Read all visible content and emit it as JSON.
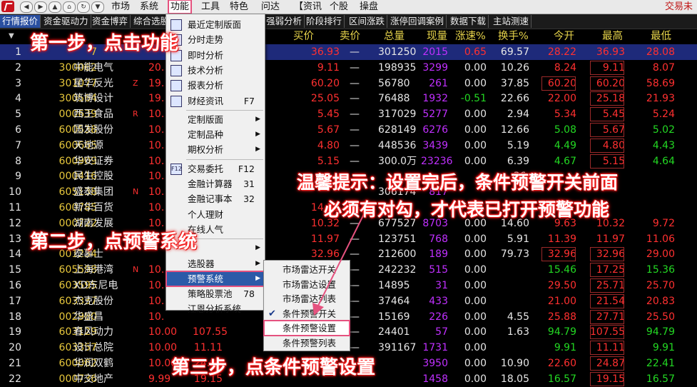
{
  "menubar": {
    "items": [
      "市场",
      "系统",
      "功能",
      "工具",
      "特色",
      "问达",
      "资讯",
      "个股",
      "操盘"
    ],
    "brand": "交易未"
  },
  "tabs": [
    "行情报价",
    "资金驱动力",
    "资金博弈",
    "综合选股",
    "强弱分析",
    "阶段排行",
    "区间涨跌",
    "涨停回调案例",
    "数据下载",
    "主站测速"
  ],
  "header": {
    "cols": [
      "买价",
      "卖价",
      "总量",
      "现量",
      "涨速%",
      "换手%",
      "今开",
      "最高",
      "最低"
    ]
  },
  "rows": [
    {
      "n": "1",
      "code": "7",
      "name": "",
      "a": "",
      "b": "",
      "buy": "36.93",
      "sell": "—",
      "vol": "301250",
      "cur": "2015",
      "spd": "0.65",
      "turn": "69.57",
      "open": "28.22",
      "high": "36.93",
      "low": "28.08"
    },
    {
      "n": "2",
      "code": "300062",
      "name": "中能电气",
      "a": "20.",
      "b": "",
      "buy": "9.11",
      "sell": "—",
      "vol": "198935",
      "cur": "3299",
      "spd": "0.00",
      "turn": "10.26",
      "open": "8.24",
      "high": "9.11",
      "low": "8.07"
    },
    {
      "n": "3",
      "code": "301077",
      "name": "星华反光",
      "a": "19.",
      "b": "Z",
      "buy": "60.20",
      "sell": "—",
      "vol": "56780",
      "cur": "261",
      "spd": "0.00",
      "turn": "37.85",
      "open": "60.20",
      "high": "60.20",
      "low": "58.69"
    },
    {
      "n": "4",
      "code": "300564",
      "name": "筑博设计",
      "a": "19.",
      "b": "",
      "buy": "25.05",
      "sell": "—",
      "vol": "76488",
      "cur": "1932",
      "spd": "-0.51",
      "turn": "22.66",
      "open": "22.00",
      "high": "25.18",
      "low": "21.93"
    },
    {
      "n": "5",
      "code": "000639",
      "name": "西王食品",
      "a": "10.",
      "b": "R",
      "buy": "5.45",
      "sell": "—",
      "vol": "317029",
      "cur": "5277",
      "spd": "0.00",
      "turn": "2.94",
      "open": "5.34",
      "high": "5.45",
      "low": "5.24"
    },
    {
      "n": "6",
      "code": "600538",
      "name": "国发股份",
      "a": "10.",
      "b": "",
      "buy": "5.67",
      "sell": "—",
      "vol": "628149",
      "cur": "6276",
      "spd": "0.00",
      "turn": "12.66",
      "open": "5.08",
      "high": "5.67",
      "low": "5.02"
    },
    {
      "n": "7",
      "code": "600665",
      "name": "天地源",
      "a": "10.",
      "b": "",
      "buy": "4.80",
      "sell": "—",
      "vol": "448536",
      "cur": "3439",
      "spd": "0.00",
      "turn": "5.19",
      "open": "4.49",
      "high": "4.80",
      "low": "4.43"
    },
    {
      "n": "8",
      "code": "600909",
      "name": "华安证券",
      "a": "10.",
      "b": "",
      "buy": "5.15",
      "sell": "—",
      "vol": "300.0万",
      "cur": "23236",
      "spd": "0.00",
      "turn": "6.39",
      "open": "4.67",
      "high": "5.15",
      "low": "4.64"
    },
    {
      "n": "9",
      "code": "000416",
      "name": "民生控股",
      "a": "10.",
      "b": "",
      "buy": "",
      "sell": "",
      "vol": "",
      "cur": "",
      "spd": "",
      "turn": "36.",
      "open": "",
      "high": "",
      "low": ""
    },
    {
      "n": "10",
      "code": "605138",
      "name": "盛泰集团",
      "a": "10.",
      "b": "N",
      "buy": "",
      "sell": "",
      "vol": "306174",
      "cur": "817",
      "spd": "",
      "turn": "",
      "open": "",
      "high": "",
      "low": ""
    },
    {
      "n": "11",
      "code": "600785",
      "name": "新华百货",
      "a": "10.",
      "b": "",
      "buy": "14.38",
      "sell": "—",
      "vol": "",
      "cur": "",
      "spd": "",
      "turn": "",
      "open": "",
      "high": "",
      "low": ""
    },
    {
      "n": "12",
      "code": "000722",
      "name": "湖南发展",
      "a": "10.",
      "b": "",
      "buy": "10.32",
      "sell": "—",
      "vol": "677527",
      "cur": "8703",
      "spd": "0.00",
      "turn": "14.60",
      "open": "9.63",
      "high": "10.32",
      "low": "9.72"
    },
    {
      "n": "13",
      "code": "",
      "name": "",
      "a": "",
      "b": "",
      "buy": "11.97",
      "sell": "—",
      "vol": "123751",
      "cur": "768",
      "spd": "0.00",
      "turn": "5.91",
      "open": "11.39",
      "high": "11.97",
      "low": "11.06"
    },
    {
      "n": "14",
      "code": "001234",
      "name": "泰慕士",
      "a": "",
      "b": "",
      "buy": "32.96",
      "sell": "—",
      "vol": "212600",
      "cur": "189",
      "spd": "0.00",
      "turn": "79.73",
      "open": "32.96",
      "high": "32.96",
      "low": "29.00"
    },
    {
      "n": "15",
      "code": "605598",
      "name": "上海港湾",
      "a": "10.",
      "b": "N",
      "buy": "",
      "sell": "—",
      "vol": "242232",
      "cur": "515",
      "spd": "0.00",
      "turn": "",
      "open": "15.46",
      "high": "17.25",
      "low": "15.36"
    },
    {
      "n": "16",
      "code": "603595",
      "name": "XD东尼电",
      "a": "10.",
      "b": "",
      "buy": "",
      "sell": "—",
      "vol": "14895",
      "cur": "31",
      "spd": "0.00",
      "turn": "",
      "open": "29.50",
      "high": "25.71",
      "low": "25.70"
    },
    {
      "n": "17",
      "code": "603337",
      "name": "杰克股份",
      "a": "10.",
      "b": "",
      "buy": "",
      "sell": "—",
      "vol": "37464",
      "cur": "433",
      "spd": "0.00",
      "turn": "",
      "open": "21.00",
      "high": "21.54",
      "low": "20.83"
    },
    {
      "n": "18",
      "code": "002980",
      "name": "华盛昌",
      "a": "10.",
      "b": "",
      "buy": "",
      "sell": "—",
      "vol": "15169",
      "cur": "226",
      "spd": "0.00",
      "turn": "4.55",
      "open": "25.88",
      "high": "27.71",
      "low": "25.50"
    },
    {
      "n": "19",
      "code": "603129",
      "name": "春风动力",
      "a": "10.00",
      "b": "",
      "c": "107.55",
      "buy": "",
      "sell": "—",
      "vol": "24401",
      "cur": "57",
      "spd": "0.00",
      "turn": "1.63",
      "open": "94.79",
      "high": "107.55",
      "low": "94.79"
    },
    {
      "n": "20",
      "code": "603357",
      "name": "设计总院",
      "a": "10.00",
      "b": "",
      "c": "11.11",
      "buy": "",
      "sell": "—",
      "vol": "391167",
      "cur": "1731",
      "spd": "0.00",
      "turn": "",
      "open": "9.91",
      "high": "11.11",
      "low": "9.91"
    },
    {
      "n": "21",
      "code": "600062",
      "name": "华润双鹤",
      "a": "10.00",
      "b": "",
      "c": "24.87",
      "buy": "",
      "sell": "",
      "vol": "",
      "cur": "3950",
      "spd": "0.00",
      "turn": "10.90",
      "open": "22.60",
      "high": "24.87",
      "low": "22.41"
    },
    {
      "n": "22",
      "code": "000736",
      "name": "中交地产",
      "a": "9.99",
      "b": "",
      "c": "19.15",
      "buy": "",
      "sell": "",
      "vol": "",
      "cur": "1458",
      "spd": "0.00",
      "turn": "18.05",
      "open": "16.57",
      "high": "19.15",
      "low": "16.57"
    }
  ],
  "menu1": {
    "items": [
      {
        "label": "最近定制版面",
        "sc": "",
        "arrow": false,
        "icon": "layout-icon"
      },
      {
        "label": "分时走势",
        "sc": "",
        "arrow": false,
        "icon": "chart-icon",
        "partial": "价"
      },
      {
        "label": "即时分析",
        "sc": "",
        "arrow": false,
        "icon": "analysis-icon"
      },
      {
        "label": "技术分析",
        "sc": "",
        "arrow": false,
        "icon": "candle-icon"
      },
      {
        "label": "报表分析",
        "sc": "",
        "arrow": false,
        "icon": "report-icon"
      },
      {
        "label": "财经资讯",
        "sc": "F7",
        "arrow": false,
        "icon": "news-icon"
      },
      {
        "label": "定制版面",
        "sc": "",
        "arrow": true
      },
      {
        "label": "定制品种",
        "sc": "",
        "arrow": true
      },
      {
        "label": "期权分析",
        "sc": "",
        "arrow": true
      },
      {
        "label": "交易委托",
        "sc": "F12",
        "arrow": false,
        "icon": "f12-icon"
      },
      {
        "label": "金融计算器",
        "sc": "31",
        "arrow": false
      },
      {
        "label": "金融记事本",
        "sc": "32",
        "arrow": false
      },
      {
        "label": "个人理财",
        "sc": "",
        "arrow": false
      },
      {
        "label": "在线人气",
        "sc": "",
        "arrow": false
      },
      {
        "label": "",
        "sc": "",
        "arrow": true
      },
      {
        "label": "选股器",
        "sc": "",
        "arrow": true
      },
      {
        "label": "预警系统",
        "sc": "",
        "arrow": true
      },
      {
        "label": "策略股票池",
        "sc": "78",
        "arrow": false
      },
      {
        "label": "江恩分析系统",
        "sc": "",
        "arrow": false
      }
    ]
  },
  "menu2": {
    "items": [
      {
        "label": "市场雷达开关",
        "checked": false
      },
      {
        "label": "市场雷达设置",
        "checked": false
      },
      {
        "label": "市场雷达列表",
        "checked": false
      },
      {
        "label": "条件预警开关",
        "checked": true
      },
      {
        "label": "条件预警设置",
        "checked": false
      },
      {
        "label": "条件预警列表",
        "checked": false
      }
    ]
  },
  "annotations": {
    "step1": "第一步，点击功能",
    "step2": "第二步，点预警系统",
    "step3": "第三步，点条件预警设置",
    "tip1": "温馨提示：设置完后，条件预警开关前面",
    "tip2": "必须有对勾，才代表已打开预警功能"
  },
  "colors": {
    "up": "#ff3030",
    "down": "#23d823",
    "accent": "#e5527f",
    "header": "#e5d24a"
  }
}
